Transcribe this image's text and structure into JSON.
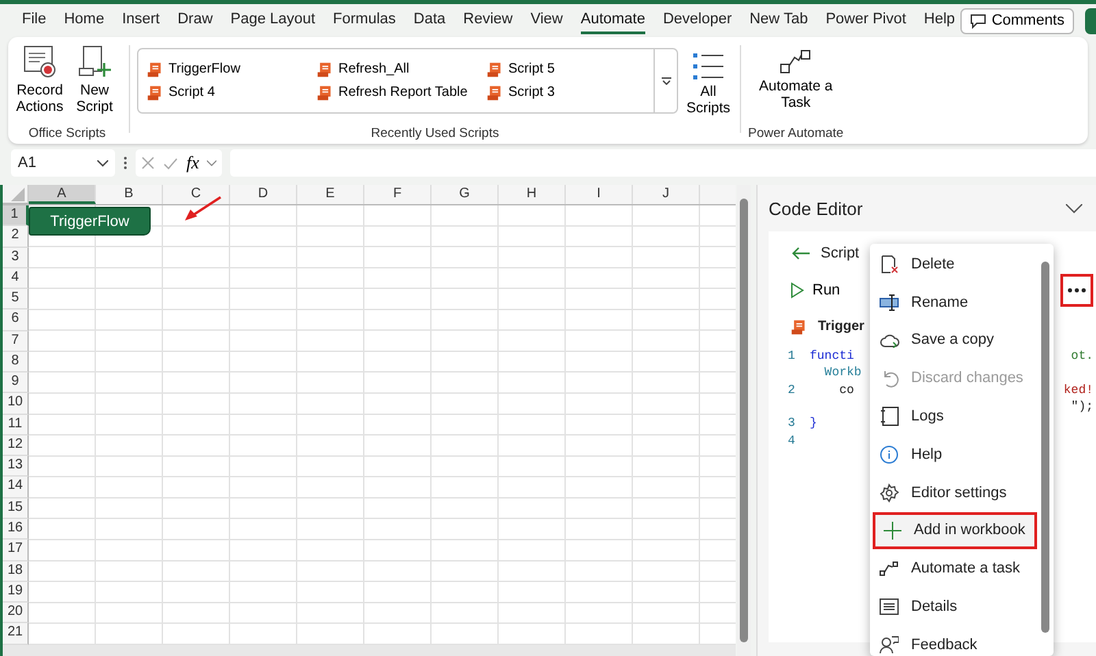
{
  "menu_tabs": [
    {
      "label": "File",
      "selected": false
    },
    {
      "label": "Home",
      "selected": false
    },
    {
      "label": "Insert",
      "selected": false
    },
    {
      "label": "Draw",
      "selected": false
    },
    {
      "label": "Page Layout",
      "selected": false
    },
    {
      "label": "Formulas",
      "selected": false
    },
    {
      "label": "Data",
      "selected": false
    },
    {
      "label": "Review",
      "selected": false
    },
    {
      "label": "View",
      "selected": false
    },
    {
      "label": "Automate",
      "selected": true
    },
    {
      "label": "Developer",
      "selected": false
    },
    {
      "label": "New Tab",
      "selected": false
    },
    {
      "label": "Power Pivot",
      "selected": false
    },
    {
      "label": "Help",
      "selected": false
    }
  ],
  "comments_button": "Comments",
  "ribbon": {
    "office_scripts": {
      "buttons": [
        {
          "label": "Record Actions",
          "kind": "record"
        },
        {
          "label": "New Script",
          "kind": "new"
        }
      ],
      "group_label": "Office Scripts"
    },
    "gallery": {
      "scripts": [
        "TriggerFlow",
        "Refresh_All",
        "Script 5",
        "Script 4",
        "Refresh Report Table",
        "Script 3"
      ],
      "all_scripts": "All Scripts",
      "group_label": "Recently Used Scripts"
    },
    "power_automate": {
      "button": "Automate a Task",
      "group_label": "Power Automate"
    }
  },
  "formula_bar": {
    "name_box": "A1",
    "function_label": "fx"
  },
  "sheet": {
    "columns": [
      {
        "label": "A",
        "selected": true
      },
      {
        "label": "B",
        "selected": false
      },
      {
        "label": "C",
        "selected": false
      },
      {
        "label": "D",
        "selected": false
      },
      {
        "label": "E",
        "selected": false
      },
      {
        "label": "F",
        "selected": false
      },
      {
        "label": "G",
        "selected": false
      },
      {
        "label": "H",
        "selected": false
      },
      {
        "label": "I",
        "selected": false
      },
      {
        "label": "J",
        "selected": false
      }
    ],
    "rows": [
      {
        "label": "1",
        "selected": true
      },
      {
        "label": "2",
        "selected": false
      },
      {
        "label": "3",
        "selected": false
      },
      {
        "label": "4",
        "selected": false
      },
      {
        "label": "5",
        "selected": false
      },
      {
        "label": "6",
        "selected": false
      },
      {
        "label": "7",
        "selected": false
      },
      {
        "label": "8",
        "selected": false
      },
      {
        "label": "9",
        "selected": false
      },
      {
        "label": "10",
        "selected": false
      },
      {
        "label": "11",
        "selected": false
      },
      {
        "label": "12",
        "selected": false
      },
      {
        "label": "13",
        "selected": false
      },
      {
        "label": "14",
        "selected": false
      },
      {
        "label": "15",
        "selected": false
      },
      {
        "label": "16",
        "selected": false
      },
      {
        "label": "17",
        "selected": false
      },
      {
        "label": "18",
        "selected": false
      },
      {
        "label": "19",
        "selected": false
      },
      {
        "label": "20",
        "selected": false
      },
      {
        "label": "21",
        "selected": false
      }
    ],
    "shape_button": "TriggerFlow"
  },
  "code_editor": {
    "title": "Code Editor",
    "back_label": "Script",
    "run_label": "Run",
    "script_name": "Trigger",
    "more_annotated": true,
    "code_lines": [
      {
        "number": "1",
        "left": {
          "text": "functi",
          "kind": "keyword"
        },
        "right": {
          "text": "ot.",
          "kind": "comment"
        }
      },
      {
        "left": {
          "text": "  Workb",
          "kind": "type"
        }
      },
      {
        "number": "2",
        "left": {
          "text": "    co",
          "kind": "plain"
        },
        "right": {
          "text": "ked!",
          "kind": "string"
        }
      },
      {
        "right": {
          "text": "\");",
          "kind": "plain"
        }
      },
      {
        "number": "3",
        "left": {
          "text": "}",
          "kind": "keyword"
        }
      },
      {
        "number": "4"
      }
    ]
  },
  "context_menu": [
    {
      "label": "Delete",
      "kind": "delete",
      "disabled": false,
      "annotated": false
    },
    {
      "label": "Rename",
      "kind": "rename",
      "disabled": false,
      "annotated": false
    },
    {
      "label": "Save a copy",
      "kind": "cloud",
      "disabled": false,
      "annotated": false
    },
    {
      "label": "Discard changes",
      "kind": "undo",
      "disabled": true,
      "annotated": false
    },
    {
      "label": "Logs",
      "kind": "logs",
      "disabled": false,
      "annotated": false
    },
    {
      "label": "Help",
      "kind": "help",
      "disabled": false,
      "annotated": false
    },
    {
      "label": "Editor settings",
      "kind": "settings",
      "disabled": false,
      "annotated": false
    },
    {
      "label": "Add in workbook",
      "kind": "add",
      "disabled": false,
      "annotated": true
    },
    {
      "label": "Automate a task",
      "kind": "flow",
      "disabled": false,
      "annotated": false
    },
    {
      "label": "Details",
      "kind": "details",
      "disabled": false,
      "annotated": false
    },
    {
      "label": "Feedback",
      "kind": "feedback",
      "disabled": false,
      "annotated": false
    }
  ]
}
